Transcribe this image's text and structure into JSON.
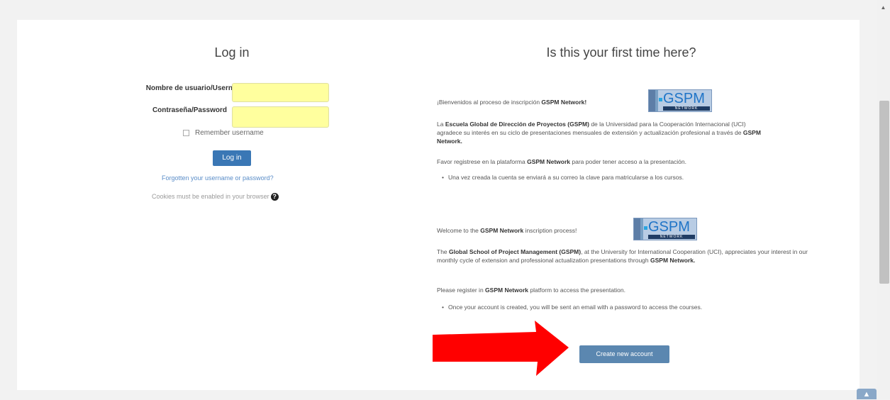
{
  "login": {
    "title": "Log in",
    "username_label": "Nombre de usuario/Username",
    "password_label": "Contraseña/Password",
    "username_value": "",
    "password_value": "",
    "remember_label": "Remember username",
    "button_label": "Log in",
    "forgot_link": "Forgotten your username or password?",
    "cookies_notice": "Cookies must be enabled in your browser"
  },
  "signup": {
    "title": "Is this your first time here?",
    "welcome_es_pre": "¡Bienvenidos al proceso de inscripción ",
    "welcome_es_brand": "GSPM Network!",
    "desc_es_pre": "La ",
    "desc_es_bold": "Escuela Global de Dirección de Proyectos (GSPM)",
    "desc_es_mid": " de la Universidad para la Cooperación Internacional (UCI) agradece su interés en su ciclo de presentaciones mensuales de extensión y actualización profesional a través de ",
    "desc_es_brand": "GSPM Network.",
    "register_es_pre": "Favor registrese en la plataforma ",
    "register_es_brand": "GSPM Network",
    "register_es_post": " para poder tener acceso a la presentación.",
    "bullet_es": "Una vez creada la cuenta se enviará a su correo la clave para matricularse a los cursos.",
    "welcome_en_pre": "Welcome to the ",
    "welcome_en_brand": "GSPM Network",
    "welcome_en_post": " inscription process!",
    "desc_en_pre": "The ",
    "desc_en_bold": "Global School of Project Management (GSPM)",
    "desc_en_mid": ", at the University for International Cooperation (UCI), appreciates your interest in our monthly cycle of extension and professional actualization presentations through ",
    "desc_en_brand": "GSPM Network.",
    "register_en_pre": "Please register in ",
    "register_en_brand": "GSPM Network",
    "register_en_post": " platform to access the presentation.",
    "bullet_en": "Once your account is created, you will be sent an email with a password to access the courses.",
    "logo_text": "GSPM",
    "logo_subtext": "NETWORK",
    "create_button": "Create new account"
  },
  "colors": {
    "primary_button": "#3a77b5",
    "input_autofill": "#ffff9e",
    "arrow": "#ff0000"
  }
}
